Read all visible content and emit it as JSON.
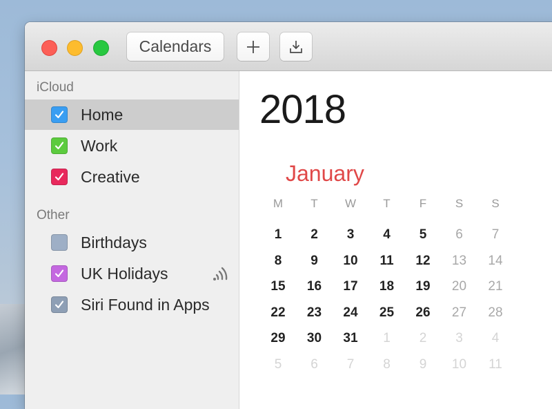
{
  "window": {
    "traffic_lights": [
      "close",
      "minimize",
      "zoom"
    ],
    "toolbar": {
      "calendars_label": "Calendars",
      "add_icon": "plus-icon",
      "export_icon": "download-tray-icon"
    }
  },
  "sidebar": {
    "sections": [
      {
        "header": "iCloud",
        "items": [
          {
            "label": "Home",
            "color": "#3a9ef2",
            "checked": true,
            "selected": true
          },
          {
            "label": "Work",
            "color": "#5ccb3e",
            "checked": true,
            "selected": false
          },
          {
            "label": "Creative",
            "color": "#e8295c",
            "checked": true,
            "selected": false
          }
        ]
      },
      {
        "header": "Other",
        "items": [
          {
            "label": "Birthdays",
            "color": "#9eafc6",
            "checked": false,
            "selected": false
          },
          {
            "label": "UK Holidays",
            "color": "#c468e0",
            "checked": true,
            "selected": false,
            "badge_icon": "subscription-feed-icon"
          },
          {
            "label": "Siri Found in Apps",
            "color": "#8e9fb5",
            "checked": true,
            "selected": false
          }
        ]
      }
    ]
  },
  "main": {
    "year": "2018",
    "month": {
      "name": "January",
      "color": "#e04848",
      "weekdays": [
        "M",
        "T",
        "W",
        "T",
        "F",
        "S",
        "S"
      ],
      "weeks": [
        [
          {
            "d": "1",
            "t": "cur"
          },
          {
            "d": "2",
            "t": "cur"
          },
          {
            "d": "3",
            "t": "cur"
          },
          {
            "d": "4",
            "t": "cur"
          },
          {
            "d": "5",
            "t": "cur"
          },
          {
            "d": "6",
            "t": "weekend"
          },
          {
            "d": "7",
            "t": "weekend"
          }
        ],
        [
          {
            "d": "8",
            "t": "cur"
          },
          {
            "d": "9",
            "t": "cur"
          },
          {
            "d": "10",
            "t": "cur"
          },
          {
            "d": "11",
            "t": "cur"
          },
          {
            "d": "12",
            "t": "cur"
          },
          {
            "d": "13",
            "t": "weekend"
          },
          {
            "d": "14",
            "t": "weekend"
          }
        ],
        [
          {
            "d": "15",
            "t": "cur"
          },
          {
            "d": "16",
            "t": "cur"
          },
          {
            "d": "17",
            "t": "cur"
          },
          {
            "d": "18",
            "t": "cur"
          },
          {
            "d": "19",
            "t": "cur"
          },
          {
            "d": "20",
            "t": "weekend"
          },
          {
            "d": "21",
            "t": "weekend"
          }
        ],
        [
          {
            "d": "22",
            "t": "cur"
          },
          {
            "d": "23",
            "t": "cur"
          },
          {
            "d": "24",
            "t": "cur"
          },
          {
            "d": "25",
            "t": "cur"
          },
          {
            "d": "26",
            "t": "cur"
          },
          {
            "d": "27",
            "t": "weekend"
          },
          {
            "d": "28",
            "t": "weekend"
          }
        ],
        [
          {
            "d": "29",
            "t": "cur"
          },
          {
            "d": "30",
            "t": "cur"
          },
          {
            "d": "31",
            "t": "cur"
          },
          {
            "d": "1",
            "t": "other"
          },
          {
            "d": "2",
            "t": "other"
          },
          {
            "d": "3",
            "t": "other"
          },
          {
            "d": "4",
            "t": "other"
          }
        ],
        [
          {
            "d": "5",
            "t": "other"
          },
          {
            "d": "6",
            "t": "other"
          },
          {
            "d": "7",
            "t": "other"
          },
          {
            "d": "8",
            "t": "other"
          },
          {
            "d": "9",
            "t": "other"
          },
          {
            "d": "10",
            "t": "other"
          },
          {
            "d": "11",
            "t": "other"
          }
        ]
      ]
    }
  }
}
